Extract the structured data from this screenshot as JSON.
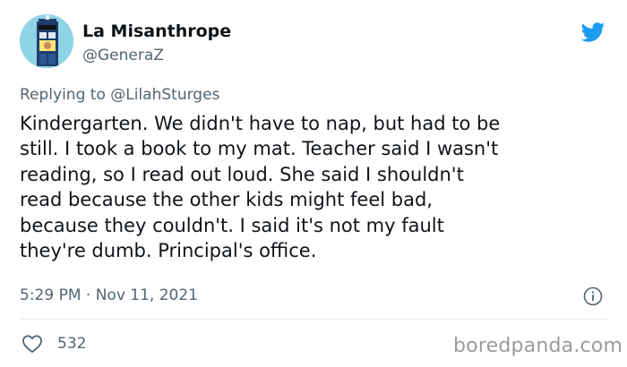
{
  "author": {
    "display_name": "La Misanthrope",
    "handle": "@GeneraZ"
  },
  "reply": {
    "prefix": "Replying to ",
    "handle": "@LilahSturges"
  },
  "tweet": {
    "text": "Kindergarten. We didn't have to nap, but had to be\nstill. I took a book to my mat. Teacher said I wasn't\nreading, so I read out loud. She said I shouldn't\nread because the other kids might feel bad,\nbecause they couldn't. I said it's not my fault\nthey're dumb. Principal's office."
  },
  "meta": {
    "timestamp": "5:29 PM · Nov 11, 2021"
  },
  "engagement": {
    "likes": "532"
  },
  "watermark": "boredpanda.com",
  "icons": {
    "brand": "twitter-bird-icon",
    "info": "info-icon",
    "like": "heart-icon"
  },
  "colors": {
    "twitter_blue": "#1d9bf0",
    "secondary_text": "#536471",
    "primary_text": "#0f1419",
    "avatar_bg": "#8fd3e6"
  }
}
